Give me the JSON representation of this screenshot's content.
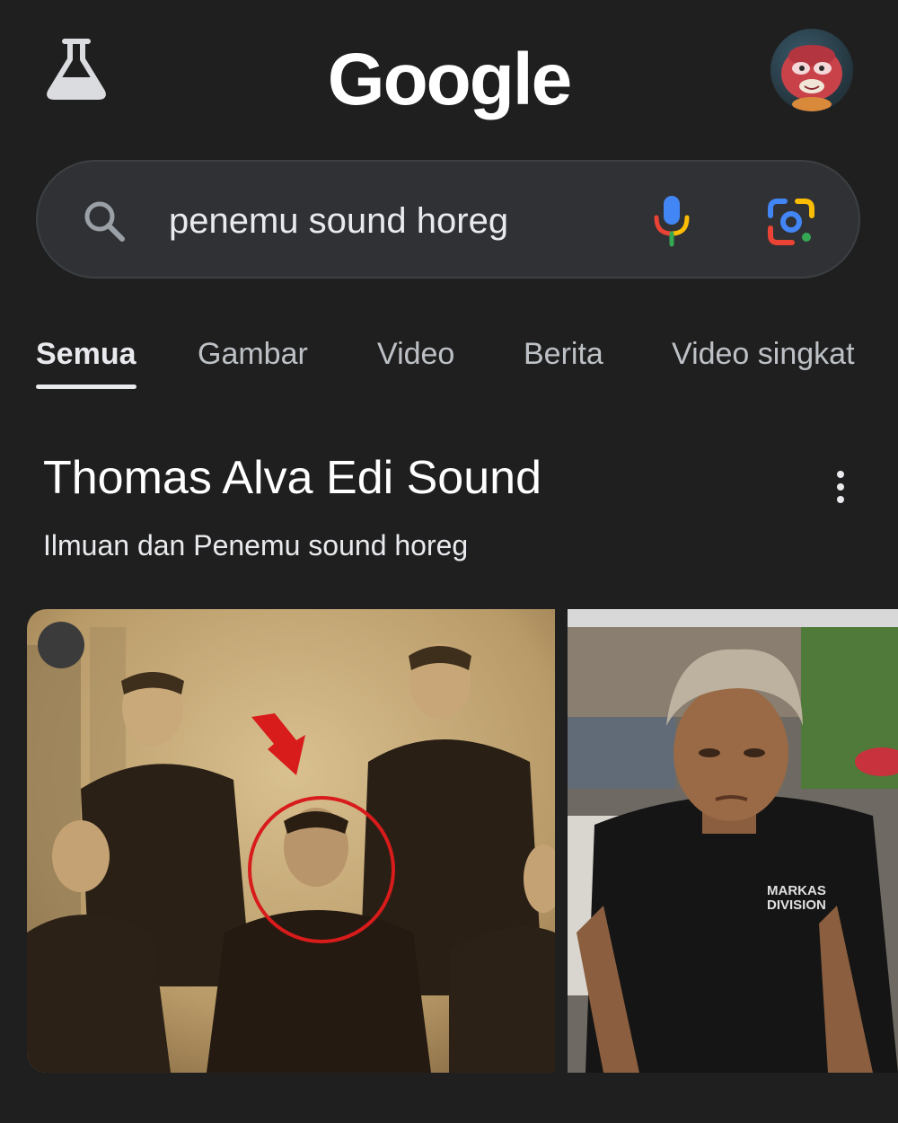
{
  "header": {
    "logo_text": "Google",
    "labs_icon": "flask-icon",
    "avatar_icon": "profile-avatar"
  },
  "search": {
    "query": "penemu sound horeg",
    "search_icon": "search-icon",
    "mic_icon": "microphone-icon",
    "lens_icon": "google-lens-icon"
  },
  "tabs": [
    {
      "label": "Semua",
      "active": true
    },
    {
      "label": "Gambar",
      "active": false
    },
    {
      "label": "Video",
      "active": false
    },
    {
      "label": "Berita",
      "active": false
    },
    {
      "label": "Video singkat",
      "active": false
    }
  ],
  "knowledge_panel": {
    "title": "Thomas Alva Edi Sound",
    "subtitle": "Ilmuan dan Penemu sound horeg",
    "menu_icon": "more-vert-icon",
    "images": [
      {
        "caption_text": "MARKAS DIVISION"
      }
    ]
  },
  "colors": {
    "background": "#1f1f1f",
    "search_bg": "#303134",
    "text_primary": "#e8eaed",
    "text_secondary": "#bdc1c6",
    "annotation_red": "#d81b1b"
  }
}
